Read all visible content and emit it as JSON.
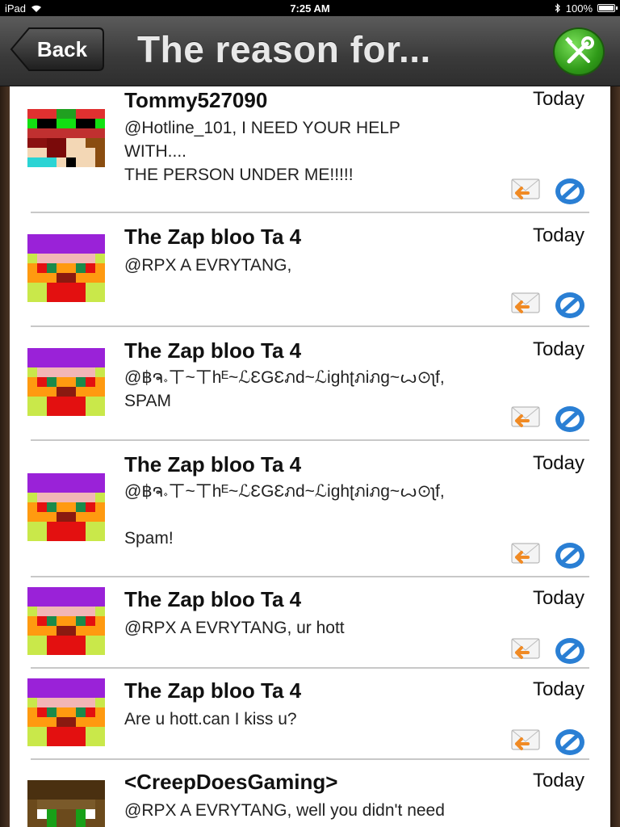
{
  "status_bar": {
    "device": "iPad",
    "time": "7:25 AM",
    "battery": "100%",
    "battery_level": 1.0
  },
  "nav": {
    "back_label": "Back",
    "title": "The reason for...",
    "tools_icon": "tools-icon"
  },
  "colors": {
    "nav_bg": "#3a3a3a",
    "tools_green": "#2f9a18",
    "divider": "#c8c8c8",
    "block_blue": "#2a7fd4",
    "reply_orange": "#f08a24"
  },
  "posts": [
    {
      "author": "Tommy527090",
      "time": "Today",
      "message": "@Hotline_101, I NEED YOUR HELP\nWITH....\nTHE PERSON UNDER ME!!!!!",
      "avatar": "pixel-avatar-red-green"
    },
    {
      "author": "The Zap bloo Ta 4",
      "time": "Today",
      "message": "@RPX A EVRYTANG,",
      "avatar": "pixel-avatar-purple"
    },
    {
      "author": "The Zap bloo Ta 4",
      "time": "Today",
      "message": "@฿ຈ𝆹ㄒ~ㄒhᴱ~ℒƐGƐภd~ℒighʈภiภg~ꙍ⊙ʅf,\nSPAM",
      "avatar": "pixel-avatar-purple"
    },
    {
      "author": "The Zap bloo Ta 4",
      "time": "Today",
      "message": "@฿ຈ𝆹ㄒ~ㄒhᴱ~ℒƐGƐภd~ℒighʈภiภg~ꙍ⊙ʅf,\n\nSpam!",
      "avatar": "pixel-avatar-purple"
    },
    {
      "author": "The Zap bloo Ta 4",
      "time": "Today",
      "message": "@RPX A EVRYTANG, ur hott",
      "avatar": "pixel-avatar-purple"
    },
    {
      "author": "The Zap bloo Ta 4",
      "time": "Today",
      "message": "Are u hott.can I kiss u?",
      "avatar": "pixel-avatar-purple"
    },
    {
      "author": "<CreepDoesGaming>",
      "time": "Today",
      "message": "@RPX A EVRYTANG, well you didn't need",
      "avatar": "pixel-avatar-brown"
    }
  ]
}
